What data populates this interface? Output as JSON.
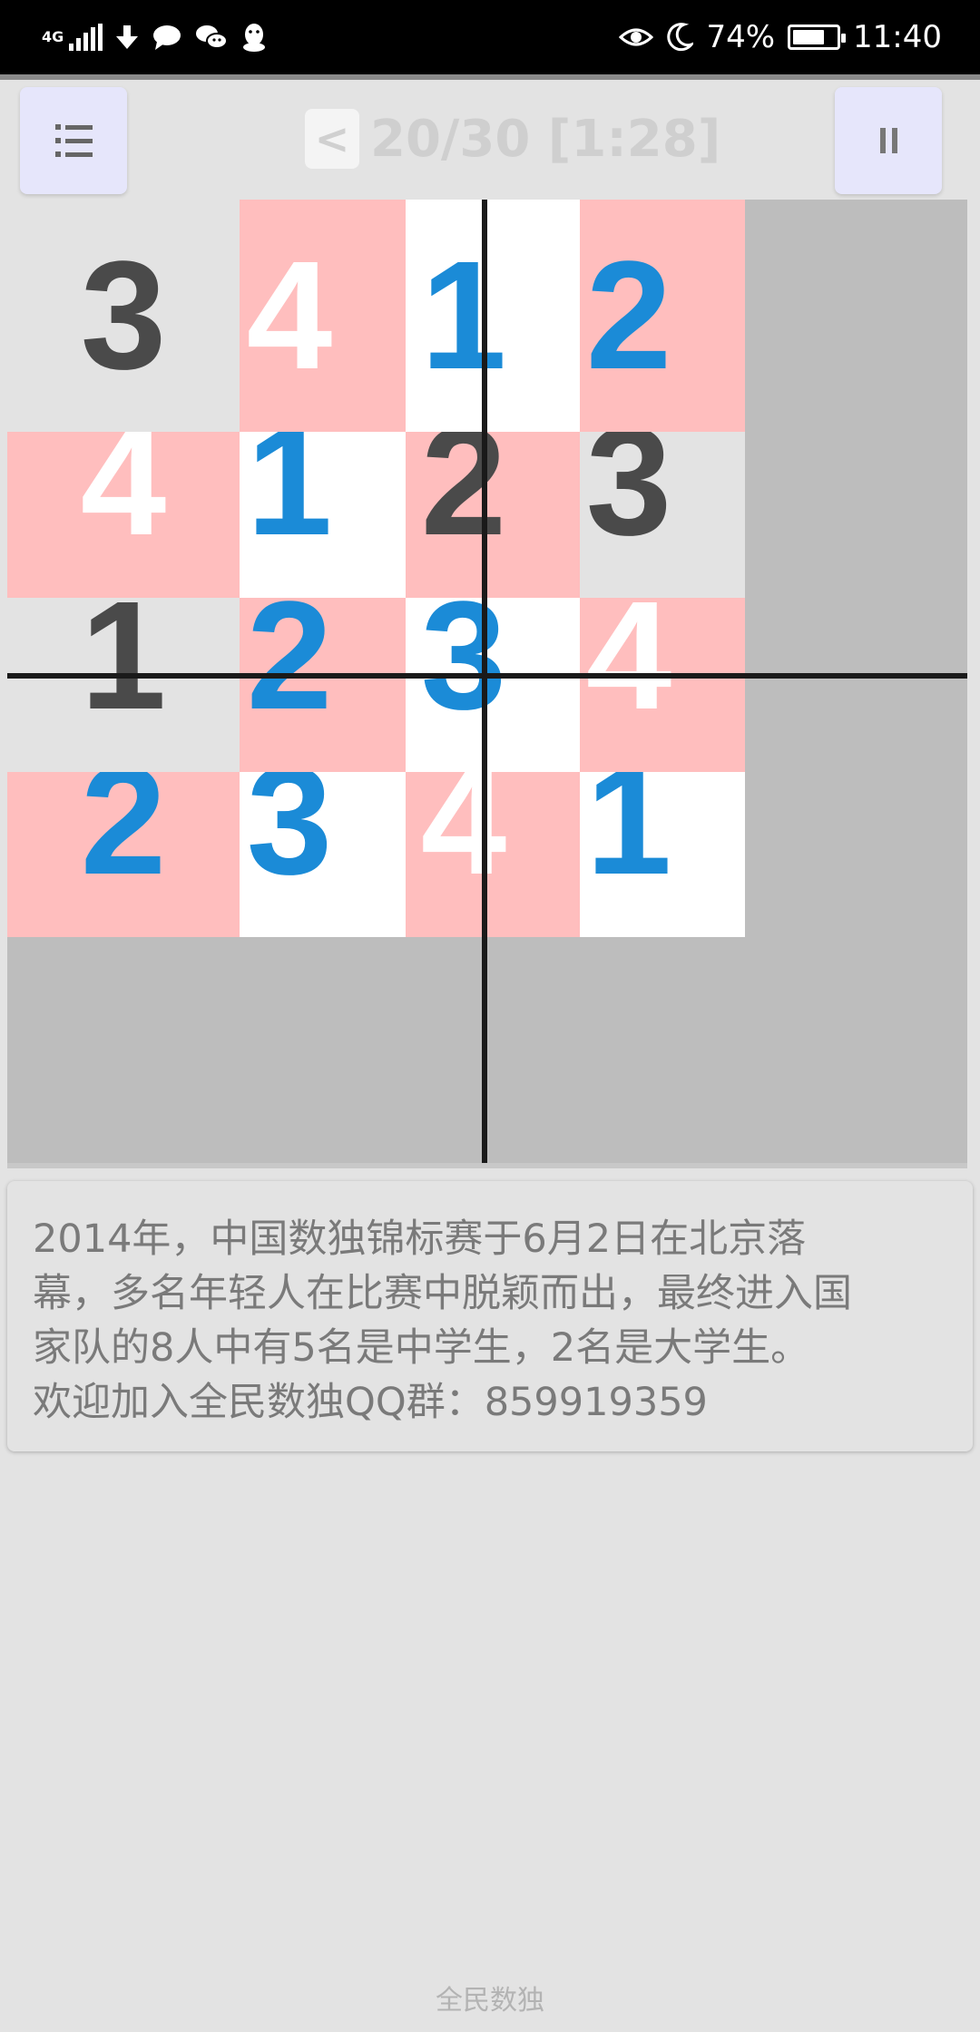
{
  "status_bar": {
    "network": "4G",
    "battery": "74%",
    "battery_level": 0.74,
    "time": "11:40",
    "icons_left": [
      "signal-icon",
      "download-icon",
      "chat-icon",
      "wechat-icon",
      "qq-icon"
    ],
    "icons_right": [
      "eye-icon",
      "moon-icon",
      "battery-icon"
    ]
  },
  "header": {
    "back_label": "<",
    "title": "20/30 [1:28]",
    "menu_icon": "menu-icon",
    "pause_icon": "pause-icon"
  },
  "board": {
    "colors": {
      "gray": "#e3e3e3",
      "pink": "#ffbebe",
      "white": "#ffffff",
      "dark_text": "#4a4a4a",
      "blue_text": "#1b8bd7"
    },
    "rows": [
      [
        {
          "value": "3",
          "bg": "gray",
          "text": "dark"
        },
        {
          "value": "4",
          "bg": "pink",
          "text": "white"
        },
        {
          "value": "1",
          "bg": "white",
          "text": "blue"
        },
        {
          "value": "2",
          "bg": "pink",
          "text": "blue"
        }
      ],
      [
        {
          "value": "4",
          "bg": "pink",
          "text": "white"
        },
        {
          "value": "1",
          "bg": "white",
          "text": "blue"
        },
        {
          "value": "2",
          "bg": "pink",
          "text": "dark"
        },
        {
          "value": "3",
          "bg": "gray",
          "text": "dark"
        }
      ],
      [
        {
          "value": "1",
          "bg": "gray",
          "text": "dark"
        },
        {
          "value": "2",
          "bg": "pink",
          "text": "blue"
        },
        {
          "value": "3",
          "bg": "white",
          "text": "blue"
        },
        {
          "value": "4",
          "bg": "pink",
          "text": "white"
        }
      ],
      [
        {
          "value": "2",
          "bg": "pink",
          "text": "blue"
        },
        {
          "value": "3",
          "bg": "white",
          "text": "blue"
        },
        {
          "value": "4",
          "bg": "pink",
          "text": "white"
        },
        {
          "value": "1",
          "bg": "white",
          "text": "blue"
        }
      ]
    ]
  },
  "info": {
    "lines": [
      "2014年，中国数独锦标赛于6月2日在北京落",
      "幕，多名年轻人在比赛中脱颖而出，最终进入国",
      "家队的8人中有5名是中学生，2名是大学生。",
      "欢迎加入全民数独QQ群：859919359"
    ]
  },
  "footer": {
    "app_name": "全民数独"
  }
}
